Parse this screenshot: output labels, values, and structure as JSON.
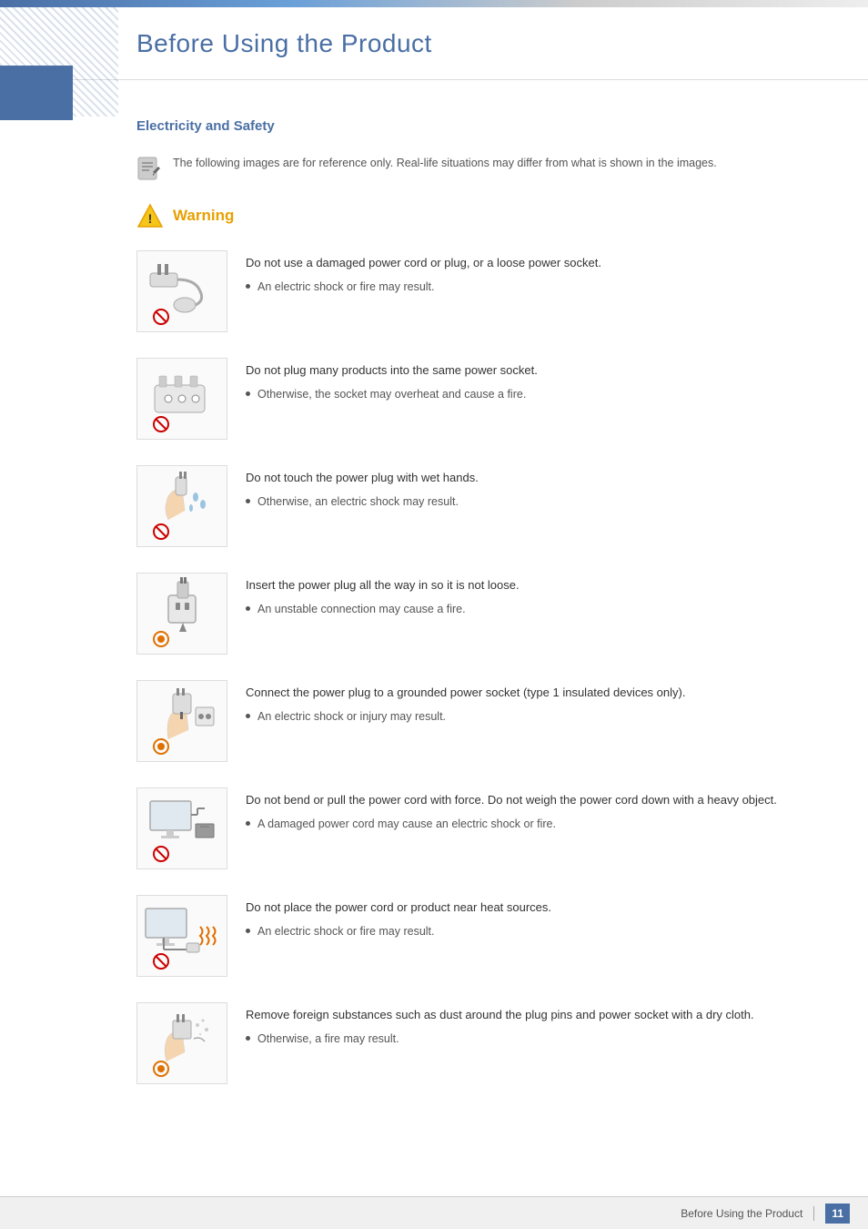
{
  "page": {
    "title": "Before Using the Product",
    "footer_text": "Before Using the Product",
    "page_number": "11"
  },
  "section": {
    "heading": "Electricity and Safety",
    "note_text": "The following images are for reference only. Real-life situations may differ from what is shown in the images."
  },
  "warning": {
    "label": "Warning",
    "items": [
      {
        "id": "item-1",
        "title": "Do not use a damaged power cord or plug, or a loose power socket.",
        "bullet": "An electric shock or fire may result."
      },
      {
        "id": "item-2",
        "title": "Do not plug many products into the same power socket.",
        "bullet": "Otherwise, the socket may overheat and cause a fire."
      },
      {
        "id": "item-3",
        "title": "Do not touch the power plug with wet hands.",
        "bullet": "Otherwise, an electric shock may result."
      },
      {
        "id": "item-4",
        "title": "Insert the power plug all the way in so it is not loose.",
        "bullet": "An unstable connection may cause a fire."
      },
      {
        "id": "item-5",
        "title": "Connect the power plug to a grounded power socket (type 1 insulated devices only).",
        "bullet": "An electric shock or injury may result."
      },
      {
        "id": "item-6",
        "title": "Do not bend or pull the power cord with force. Do not weigh the power cord down with a heavy object.",
        "bullet": "A damaged power cord may cause an electric shock or fire."
      },
      {
        "id": "item-7",
        "title": "Do not place the power cord or product near heat sources.",
        "bullet": "An electric shock or fire may result."
      },
      {
        "id": "item-8",
        "title": "Remove foreign substances such as dust around the plug pins and power socket with a dry cloth.",
        "bullet": "Otherwise, a fire may result."
      }
    ]
  }
}
